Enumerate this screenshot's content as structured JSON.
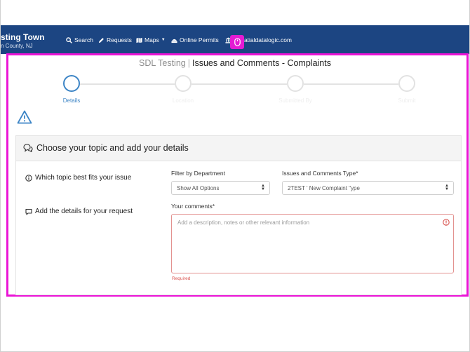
{
  "navbar": {
    "brand_name": "sting Town",
    "brand_sub": "n County, NJ",
    "items": [
      {
        "label": "Search",
        "icon": "search-icon"
      },
      {
        "label": "Requests",
        "icon": "pencil-icon"
      },
      {
        "label": "Maps",
        "icon": "map-icon"
      },
      {
        "label": "Online Permits",
        "icon": "building-icon"
      },
      {
        "label": "y.spatialdatalogic.com",
        "icon": "bank-icon"
      }
    ],
    "colors": {
      "background": "#1c4582",
      "highlight": "#ea14d6"
    }
  },
  "page": {
    "title_prefix": "SDL Testing",
    "title_separator": "|",
    "title": "Issues and Comments - Complaints"
  },
  "stepper": {
    "steps": [
      {
        "label": "Details",
        "active": true
      },
      {
        "label": "Location",
        "active": false
      },
      {
        "label": "Submitted By",
        "active": false
      },
      {
        "label": "Submit",
        "active": false
      }
    ],
    "accent": "#3d85c6"
  },
  "card": {
    "title": "Choose your topic and add your details",
    "topic_question": "Which topic best fits your issue",
    "details_question": "Add the details for your request",
    "filter_label": "Filter by Department",
    "filter_value": "Show All Options",
    "type_label": "Issues and Comments Type*",
    "type_value": "2TEST ' New Complaint \"ype",
    "comments_label": "Your comments*",
    "comments_placeholder": "Add a description, notes or other relevant information",
    "required_text": "Required"
  }
}
